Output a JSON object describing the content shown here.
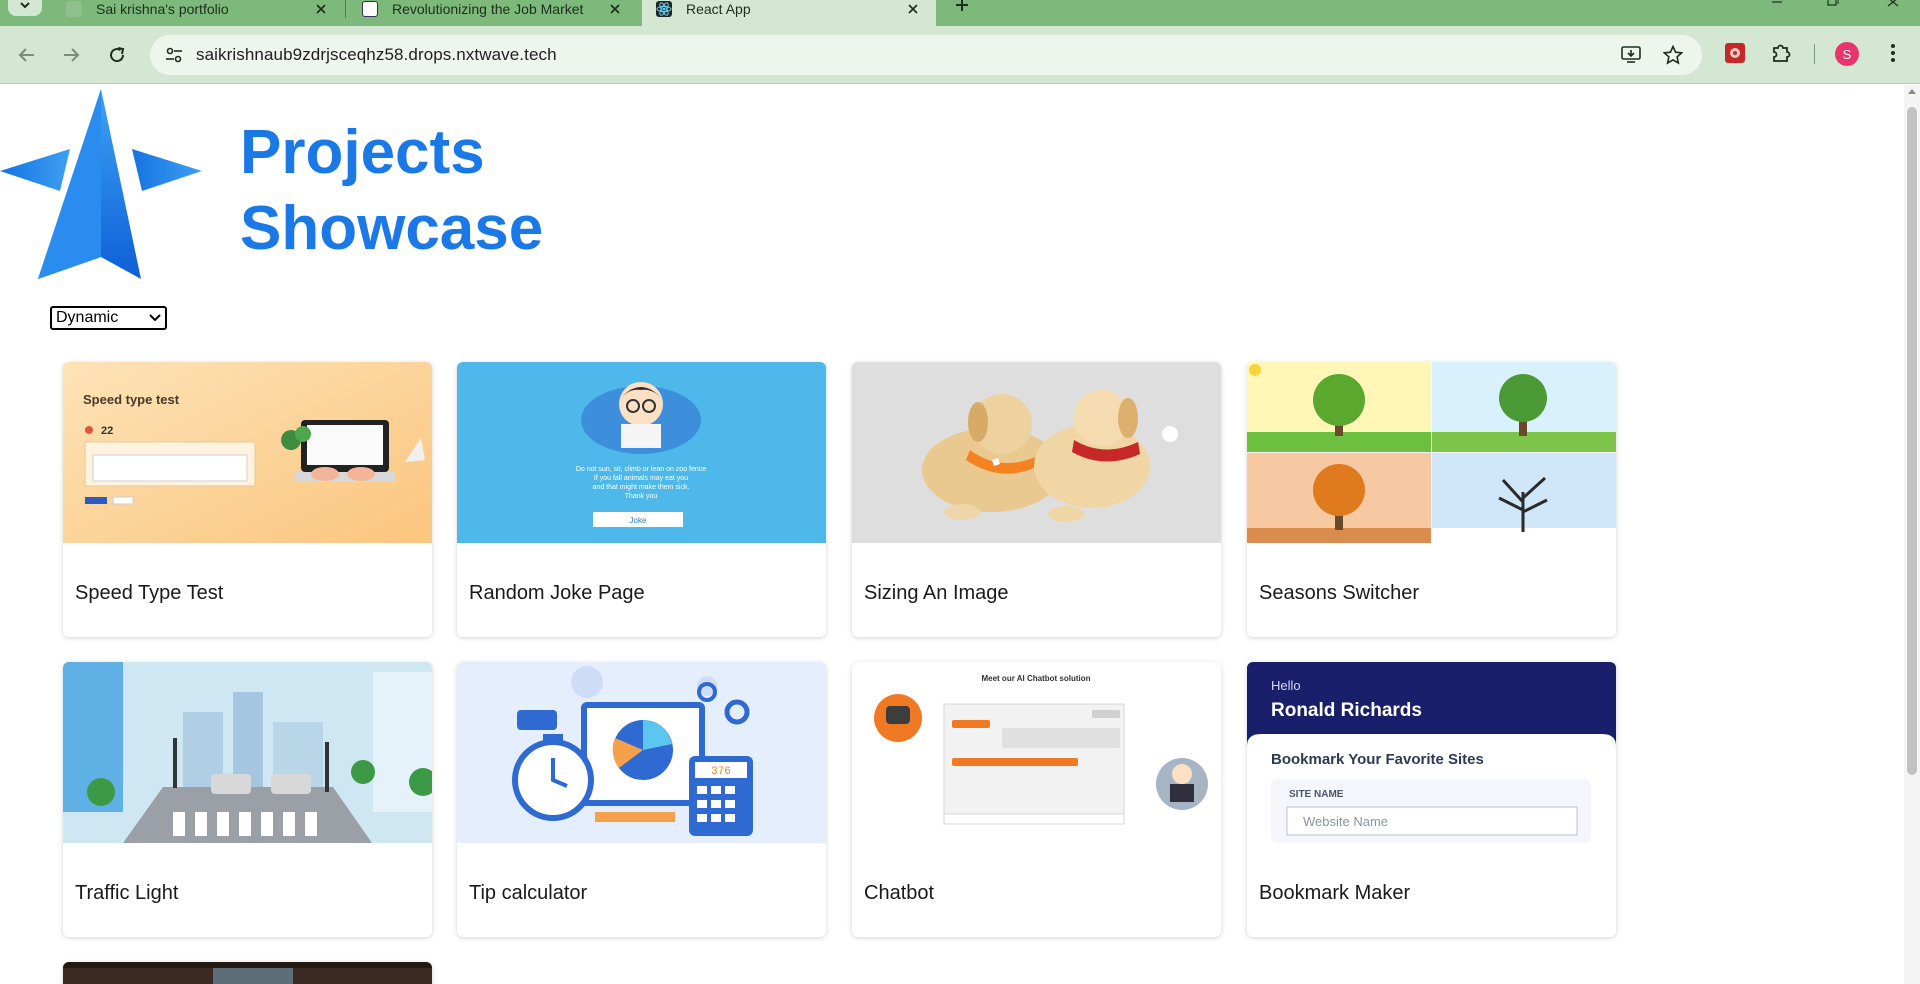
{
  "browser": {
    "tabs": [
      {
        "title": "Sai krishna's portfolio",
        "active": false
      },
      {
        "title": "Revolutionizing the Job Market",
        "active": false
      },
      {
        "title": "React App",
        "active": true
      }
    ],
    "url": "saikrishnaub9zdrjsceqhz58.drops.nxtwave.tech",
    "profile_initial": "S"
  },
  "page": {
    "heading_line1": "Projects",
    "heading_line2": "Showcase",
    "filter_selected": "Dynamic",
    "projects": [
      {
        "name": "Speed Type Test"
      },
      {
        "name": "Random Joke Page"
      },
      {
        "name": "Sizing An Image"
      },
      {
        "name": "Seasons Switcher"
      },
      {
        "name": "Traffic Light"
      },
      {
        "name": "Tip calculator"
      },
      {
        "name": "Chatbot"
      },
      {
        "name": "Bookmark Maker"
      }
    ],
    "thumb_text": {
      "speed_title": "Speed type test",
      "speed_count": "22",
      "joke_line1": "Do not sun, sit, climb or lean on zoo fence",
      "joke_line2": "If you fall animals may eat you",
      "joke_line3": "and that might make them sick.",
      "joke_line4": "Thank you",
      "joke_button": "Joke",
      "tip_display": "376",
      "chatbot_title": "Meet our AI Chatbot solution",
      "bookmark_hello": "Hello",
      "bookmark_name": "Ronald Richards",
      "bookmark_heading": "Bookmark Your Favorite Sites",
      "bookmark_label": "SITE NAME",
      "bookmark_placeholder": "Website Name"
    }
  },
  "colors": {
    "tabstrip": "#7cb97a",
    "toolbar": "#d4e7d2",
    "heading": "#1a79e6"
  }
}
